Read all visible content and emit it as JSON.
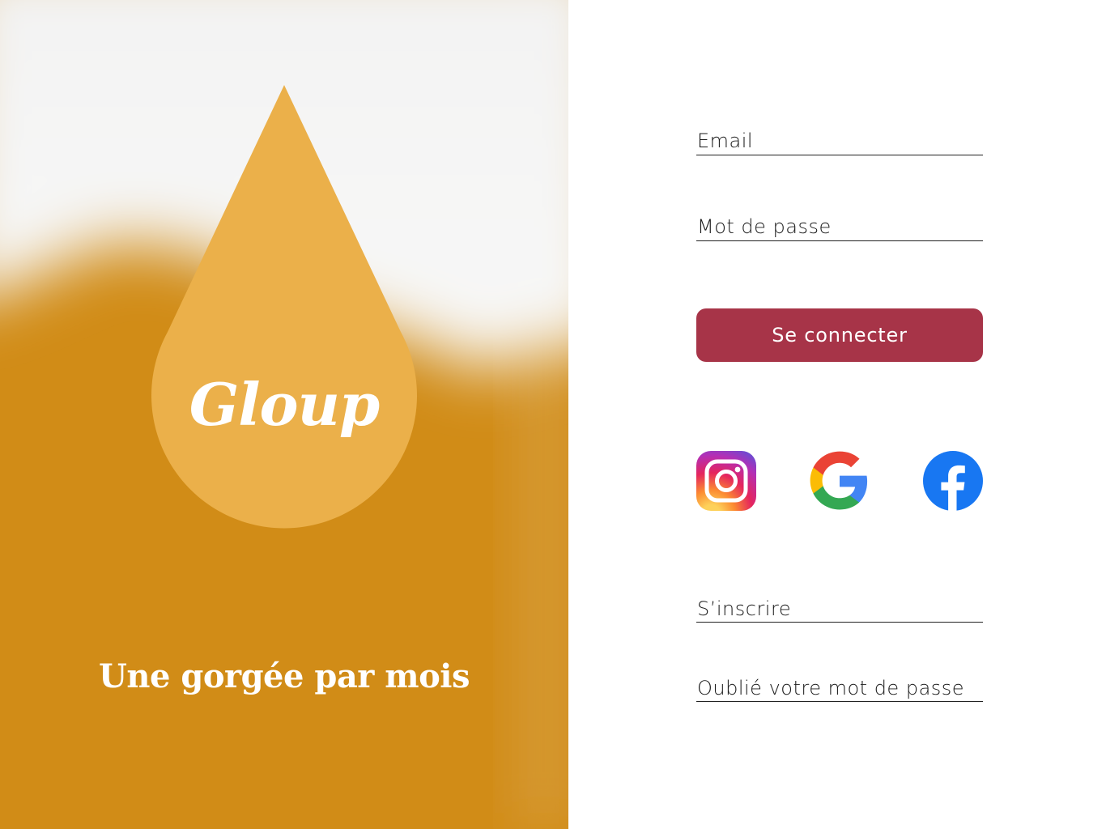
{
  "brand": {
    "name": "Gloup",
    "tagline": "Une gorgée par mois",
    "drop_color": "#ebb04a",
    "beer_color": "#d18c17",
    "foam_color": "#f7f7f6"
  },
  "login_form": {
    "email_placeholder": "Email",
    "password_placeholder": "Mot de passe",
    "submit_label": "Se connecter",
    "submit_color": "#a73448"
  },
  "social_login": [
    {
      "name": "instagram",
      "icon": "instagram-icon"
    },
    {
      "name": "google",
      "icon": "google-icon"
    },
    {
      "name": "facebook",
      "icon": "facebook-icon"
    }
  ],
  "links": {
    "signup": "S’inscrire",
    "forgot_password": "Oublié votre mot de passe"
  }
}
